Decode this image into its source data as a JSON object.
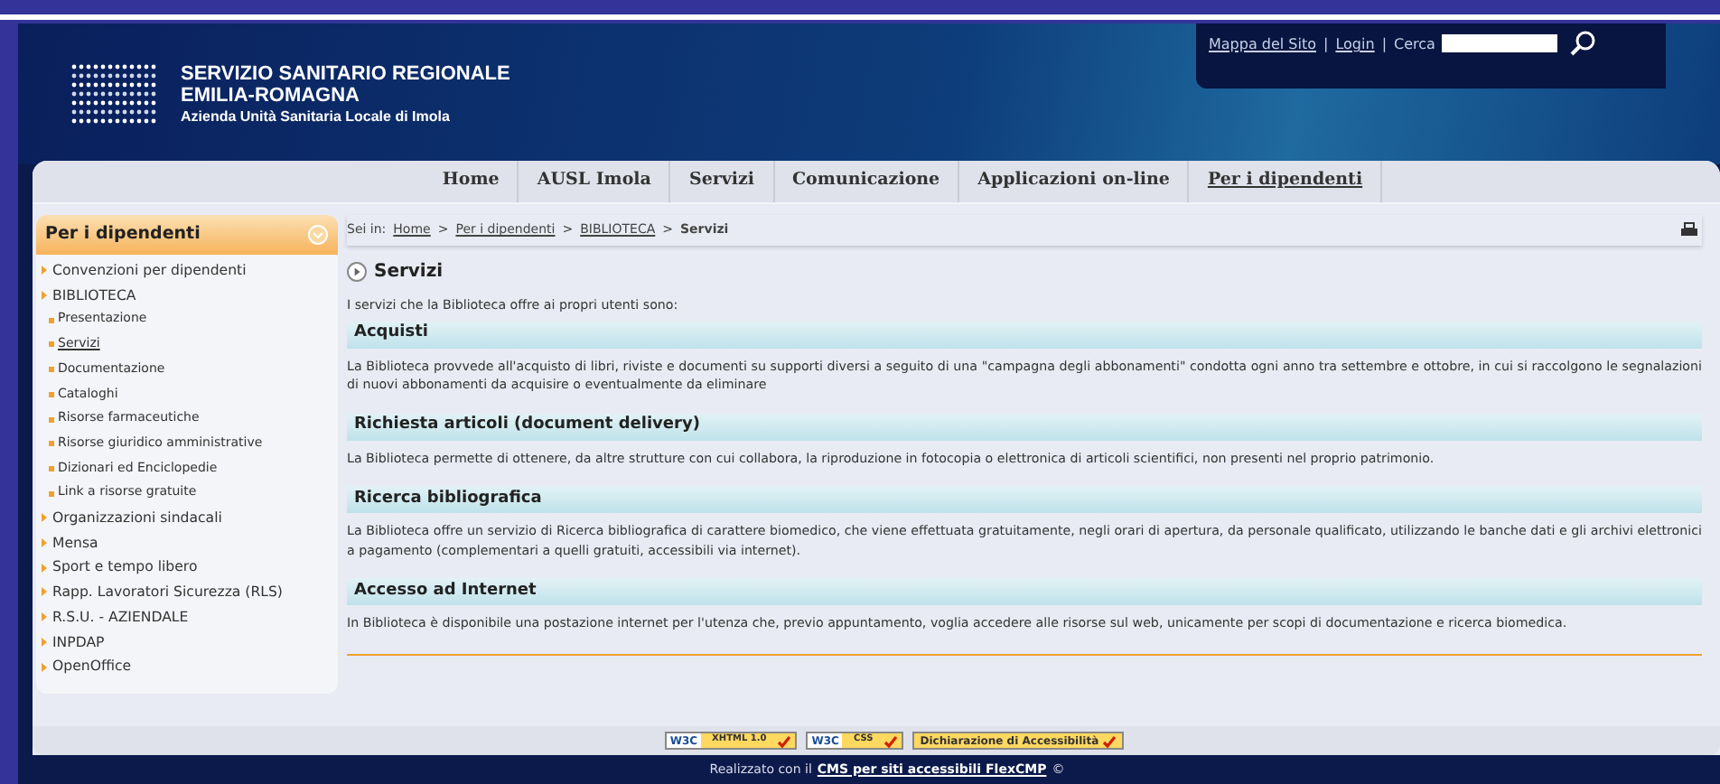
{
  "header": {
    "logo_lines": [
      "SERVIZIO SANITARIO REGIONALE",
      "EMILIA-ROMAGNA",
      "Azienda Unità Sanitaria Locale di Imola"
    ],
    "top_links": [
      "Mappa del Sito",
      "Login"
    ],
    "link_separator": "|",
    "search_label": "Cerca"
  },
  "nav": [
    {
      "label": "Home",
      "selected": false
    },
    {
      "label": "AUSL Imola",
      "selected": false
    },
    {
      "label": "Servizi",
      "selected": false
    },
    {
      "label": "Comunicazione",
      "selected": false
    },
    {
      "label": "Applicazioni on-line",
      "selected": false
    },
    {
      "label": "Per i dipendenti",
      "selected": true
    }
  ],
  "breadcrumb": {
    "prefix": "Sei in:",
    "separator": ">",
    "items": [
      {
        "label": "Home",
        "link": true
      },
      {
        "label": "Per i dipendenti",
        "link": true
      },
      {
        "label": "BIBLIOTECA",
        "link": true
      },
      {
        "label": "Servizi",
        "link": false
      }
    ]
  },
  "sidebar": {
    "title": "Per i dipendenti",
    "items": [
      {
        "label": "Convenzioni per dipendenti"
      },
      {
        "label": "BIBLIOTECA",
        "children": [
          {
            "label": "Presentazione",
            "selected": false
          },
          {
            "label": "Servizi",
            "selected": true
          },
          {
            "label": "Documentazione",
            "selected": false
          },
          {
            "label": "Cataloghi",
            "selected": false
          },
          {
            "label": "Risorse farmaceutiche",
            "selected": false
          },
          {
            "label": "Risorse giuridico amministrative",
            "selected": false
          },
          {
            "label": "Dizionari ed Enciclopedie",
            "selected": false
          },
          {
            "label": "Link a risorse gratuite",
            "selected": false
          }
        ]
      },
      {
        "label": "Organizzazioni sindacali"
      },
      {
        "label": "Mensa"
      },
      {
        "label": "Sport e tempo libero"
      },
      {
        "label": "Rapp. Lavoratori Sicurezza (RLS)"
      },
      {
        "label": "R.S.U. - AZIENDALE"
      },
      {
        "label": "INPDAP"
      },
      {
        "label": "OpenOffice"
      }
    ]
  },
  "main": {
    "title": "Servizi",
    "intro": "I servizi che la Biblioteca offre ai propri utenti sono:",
    "sections": [
      {
        "heading": "Acquisti",
        "body": "La Biblioteca provvede all'acquisto di libri, riviste e documenti su supporti diversi a seguito di una \"campagna degli abbonamenti\" condotta ogni anno tra settembre e ottobre, in cui si raccolgono le segnalazioni di nuovi abbonamenti da acquisire o eventualmente da eliminare"
      },
      {
        "heading": "Richiesta articoli (document delivery)",
        "body": "La Biblioteca permette di ottenere, da altre strutture con cui collabora, la riproduzione in fotocopia o elettronica di articoli scientifici, non presenti nel proprio patrimonio."
      },
      {
        "heading": "Ricerca bibliografica",
        "body": "La Biblioteca offre un servizio di Ricerca bibliografica di carattere biomedico, che viene effettuata gratuitamente, negli orari di apertura, da personale qualificato, utilizzando le banche dati e gli archivi elettronici a pagamento (complementari a quelli gratuiti, accessibili via internet)."
      },
      {
        "heading": "Accesso ad Internet",
        "body": "In Biblioteca è disponibile una postazione internet per l'utenza che, previo appuntamento, voglia accedere alle risorse sul web, unicamente per scopi di documentazione e ricerca biomedica."
      }
    ]
  },
  "badges": [
    {
      "kind": "w3c",
      "logo": "W3C",
      "label": "XHTML 1.0"
    },
    {
      "kind": "w3c",
      "logo": "W3C",
      "label": "CSS"
    },
    {
      "kind": "text",
      "label": "Dichiarazione di Accessibilità"
    }
  ],
  "credit": {
    "prefix": "Realizzato con il",
    "link": "CMS per siti accessibili FlexCMP",
    "suffix": "©"
  }
}
